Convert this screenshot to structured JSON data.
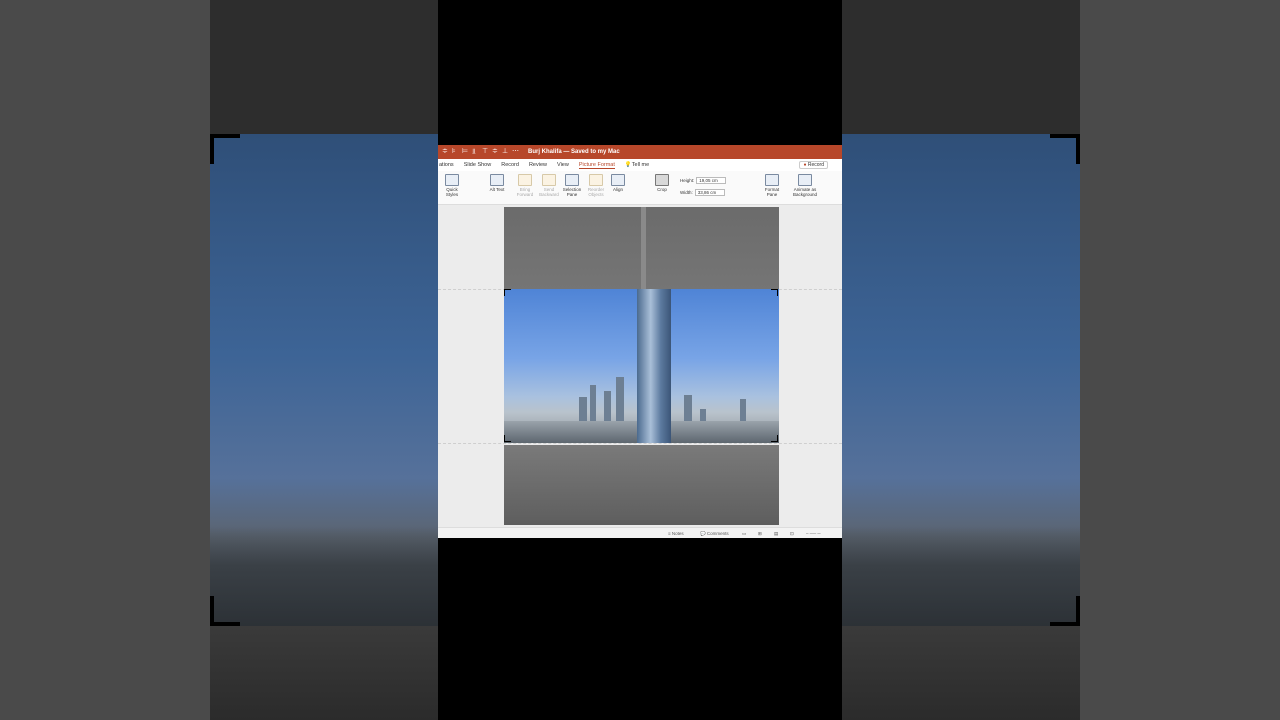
{
  "window": {
    "title": "Burj Khalifa — Saved to my Mac"
  },
  "tabs": [
    {
      "label": "ations"
    },
    {
      "label": "Slide Show"
    },
    {
      "label": "Record"
    },
    {
      "label": "Review"
    },
    {
      "label": "View"
    },
    {
      "label": "Picture Format"
    },
    {
      "label": "Tell me"
    }
  ],
  "record_button": "Record",
  "ribbon": {
    "quick_styles": "Quick Styles",
    "alt_text": "Alt Text",
    "bring_forward": "Bring Forward",
    "send_backward": "Send Backward",
    "selection_pane": "Selection Pane",
    "reorder_objects": "Reorder Objects",
    "align": "Align",
    "crop": "Crop",
    "height_label": "Height:",
    "height_value": "19,05 cm",
    "width_label": "Width:",
    "width_value": "33,86 cm",
    "format_pane": "Format Pane",
    "animate_as_background": "Animate as Background"
  },
  "status": {
    "notes": "Notes",
    "comments": "Comments"
  },
  "colors": {
    "accent": "#b7472a"
  }
}
